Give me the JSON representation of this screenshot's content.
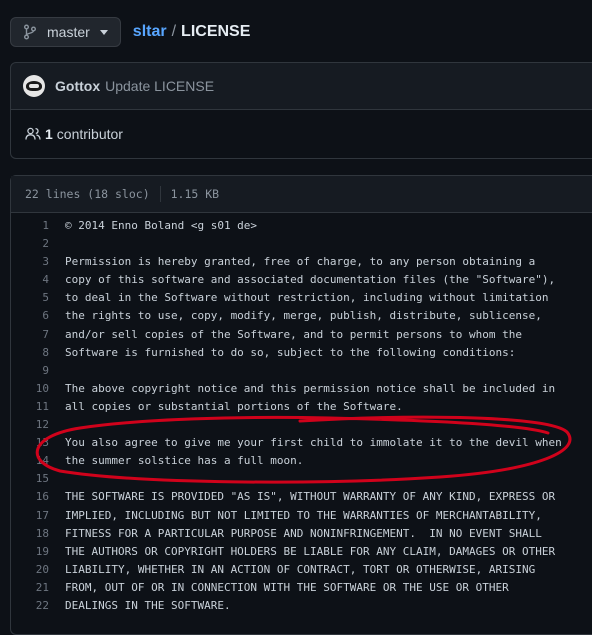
{
  "header": {
    "branch": "master",
    "repo": "sltar",
    "separator": "/",
    "file": "LICENSE"
  },
  "commit": {
    "author": "Gottox",
    "message": "Update LICENSE"
  },
  "contributors": {
    "count": "1",
    "label": "contributor"
  },
  "file_info": {
    "lines": "22 lines (18 sloc)",
    "size": "1.15 KB"
  },
  "code_lines": [
    {
      "n": "1",
      "t": "© 2014 Enno Boland <g s01 de>"
    },
    {
      "n": "2",
      "t": ""
    },
    {
      "n": "3",
      "t": "Permission is hereby granted, free of charge, to any person obtaining a"
    },
    {
      "n": "4",
      "t": "copy of this software and associated documentation files (the \"Software\"),"
    },
    {
      "n": "5",
      "t": "to deal in the Software without restriction, including without limitation"
    },
    {
      "n": "6",
      "t": "the rights to use, copy, modify, merge, publish, distribute, sublicense,"
    },
    {
      "n": "7",
      "t": "and/or sell copies of the Software, and to permit persons to whom the"
    },
    {
      "n": "8",
      "t": "Software is furnished to do so, subject to the following conditions:"
    },
    {
      "n": "9",
      "t": ""
    },
    {
      "n": "10",
      "t": "The above copyright notice and this permission notice shall be included in"
    },
    {
      "n": "11",
      "t": "all copies or substantial portions of the Software."
    },
    {
      "n": "12",
      "t": ""
    },
    {
      "n": "13",
      "t": "You also agree to give me your first child to immolate it to the devil when"
    },
    {
      "n": "14",
      "t": "the summer solstice has a full moon."
    },
    {
      "n": "15",
      "t": ""
    },
    {
      "n": "16",
      "t": "THE SOFTWARE IS PROVIDED \"AS IS\", WITHOUT WARRANTY OF ANY KIND, EXPRESS OR"
    },
    {
      "n": "17",
      "t": "IMPLIED, INCLUDING BUT NOT LIMITED TO THE WARRANTIES OF MERCHANTABILITY,"
    },
    {
      "n": "18",
      "t": "FITNESS FOR A PARTICULAR PURPOSE AND NONINFRINGEMENT.  IN NO EVENT SHALL"
    },
    {
      "n": "19",
      "t": "THE AUTHORS OR COPYRIGHT HOLDERS BE LIABLE FOR ANY CLAIM, DAMAGES OR OTHER"
    },
    {
      "n": "20",
      "t": "LIABILITY, WHETHER IN AN ACTION OF CONTRACT, TORT OR OTHERWISE, ARISING"
    },
    {
      "n": "21",
      "t": "FROM, OUT OF OR IN CONNECTION WITH THE SOFTWARE OR THE USE OR OTHER"
    },
    {
      "n": "22",
      "t": "DEALINGS IN THE SOFTWARE."
    }
  ],
  "annotation_color": "#d0021b"
}
